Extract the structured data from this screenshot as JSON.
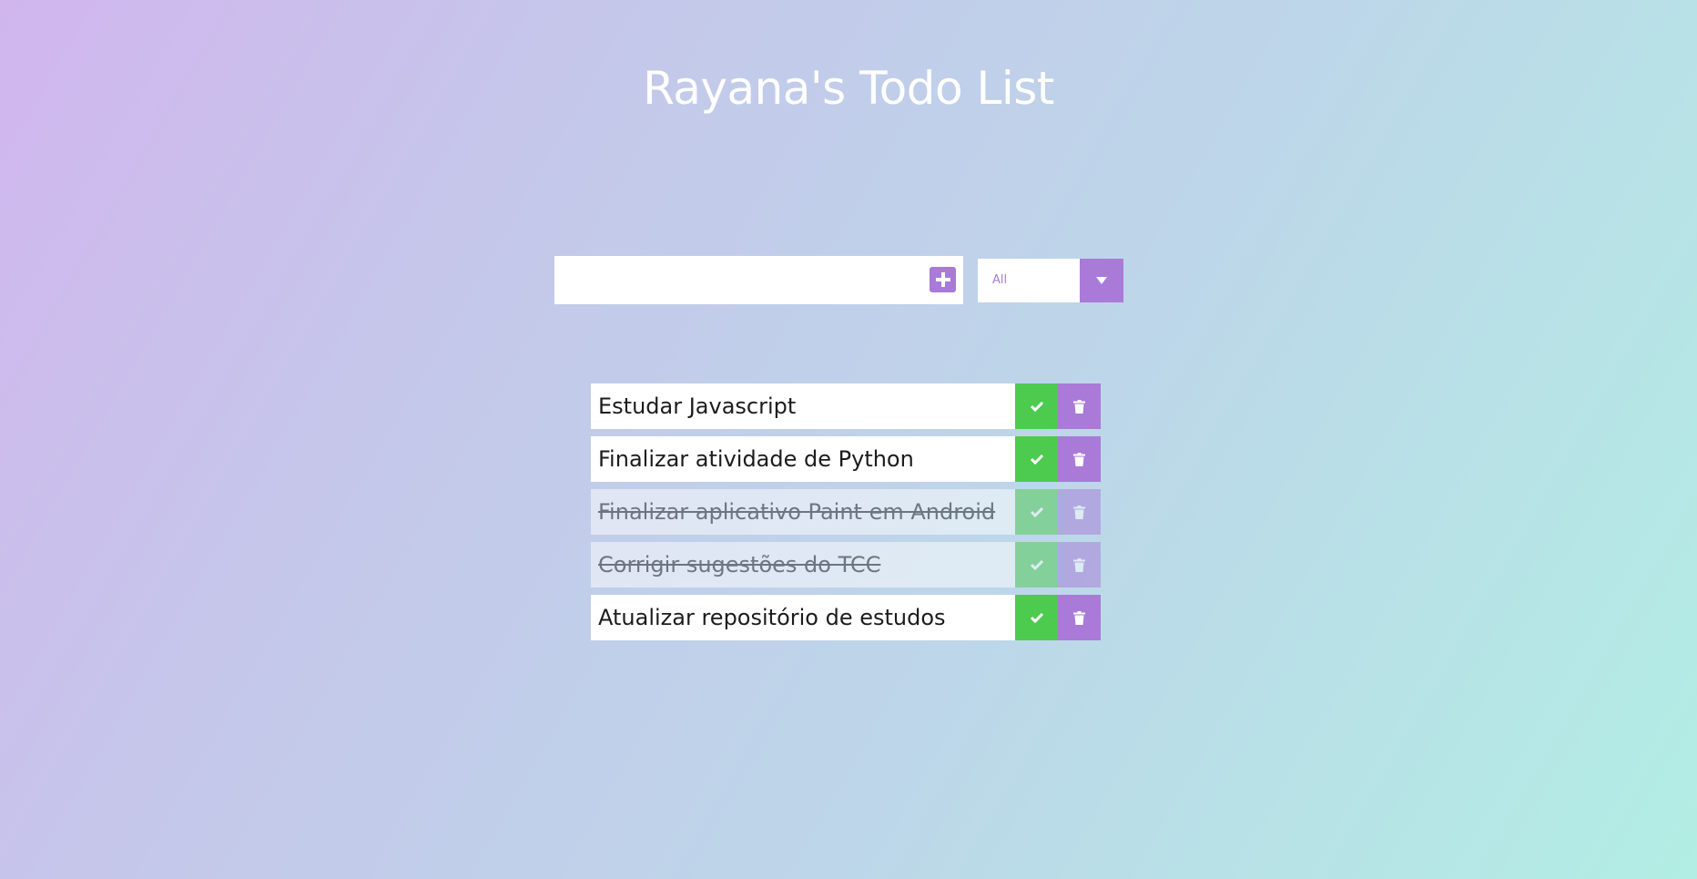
{
  "header": {
    "title": "Rayana's Todo List"
  },
  "form": {
    "input_value": "",
    "add_icon": "plus-icon",
    "filter_selected": "All",
    "filter_icon": "caret-down-icon"
  },
  "todos": [
    {
      "text": "Estudar Javascript",
      "completed": false
    },
    {
      "text": "Finalizar atividade de Python",
      "completed": false
    },
    {
      "text": "Finalizar aplicativo Paint em Android",
      "completed": true
    },
    {
      "text": "Corrigir sugestões do TCC",
      "completed": true
    },
    {
      "text": "Atualizar repositório de estudos",
      "completed": false
    }
  ],
  "icons": {
    "complete": "check-icon",
    "delete": "trash-icon"
  },
  "colors": {
    "accent": "#a97ad8",
    "complete": "#4ccb4e",
    "title": "#ffffff"
  }
}
